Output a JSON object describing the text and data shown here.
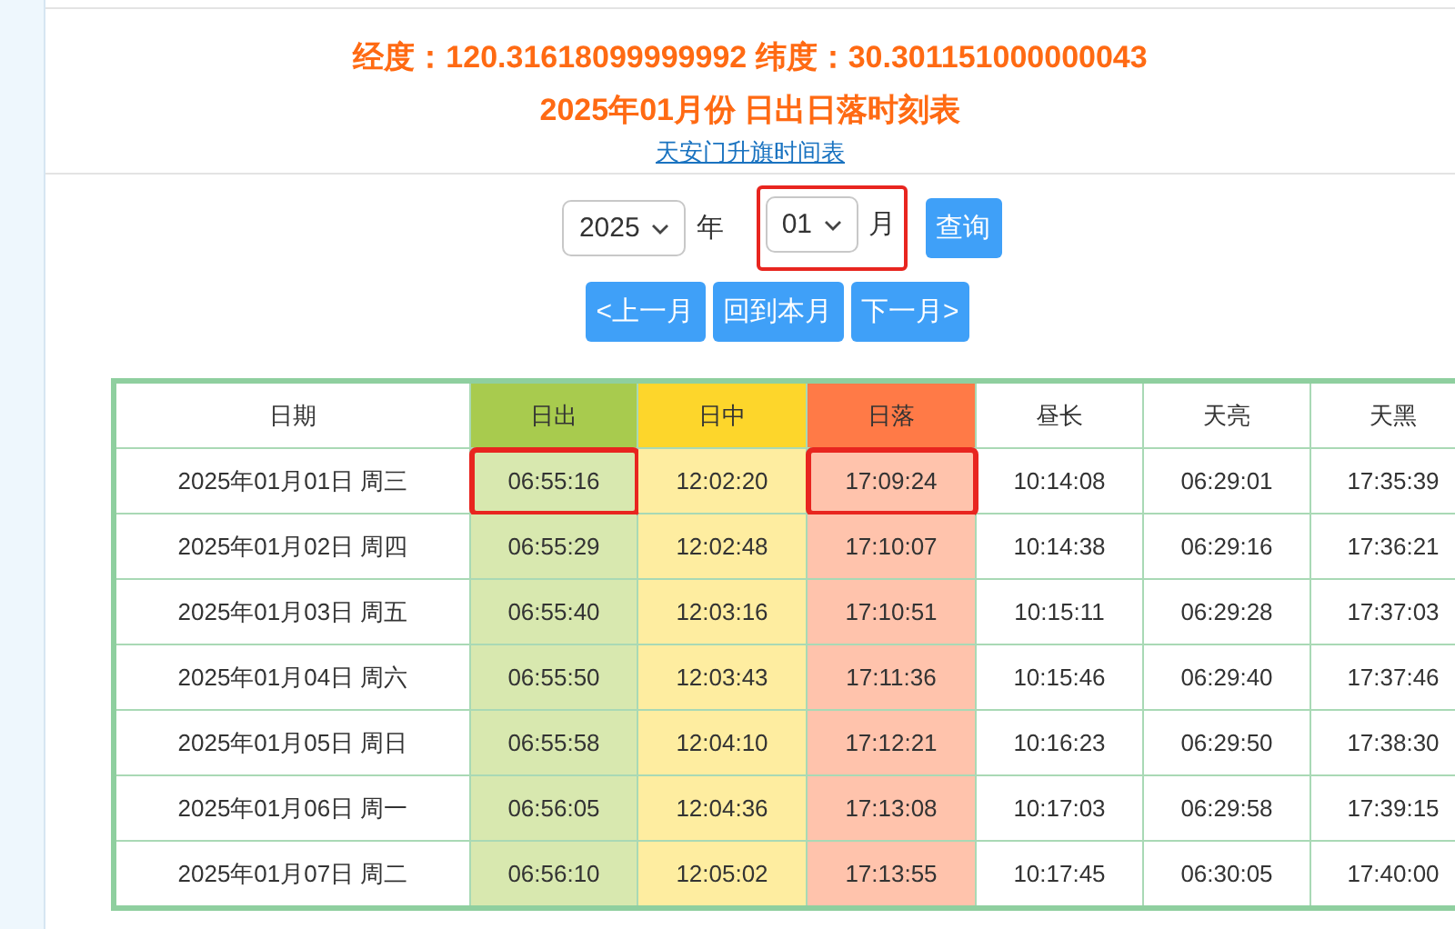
{
  "header": {
    "coordinates": "经度：120.31618099999992 纬度：30.301151000000043",
    "title": "2025年01月份 日出日落时刻表",
    "link": "天安门升旗时间表"
  },
  "query": {
    "year": {
      "value": "2025",
      "unit": "年",
      "highlighted": false
    },
    "month": {
      "value": "01",
      "unit": "月",
      "highlighted": true
    },
    "button": "查询"
  },
  "nav_buttons": [
    "<上一月",
    "回到本月",
    "下一月>"
  ],
  "table": {
    "columns": [
      {
        "label": "日期"
      },
      {
        "label": "日出",
        "color": "#a8cb4e"
      },
      {
        "label": "日中",
        "color": "#fdd62b"
      },
      {
        "label": "日落",
        "color": "#ff7a47"
      },
      {
        "label": "昼长"
      },
      {
        "label": "天亮"
      },
      {
        "label": "天黑"
      }
    ],
    "rows": [
      {
        "cells": [
          {
            "text": "2025年01月01日 周三",
            "highlighted": false
          },
          {
            "text": "06:55:16",
            "highlighted": true
          },
          {
            "text": "12:02:20",
            "highlighted": false
          },
          {
            "text": "17:09:24",
            "highlighted": true
          },
          {
            "text": "10:14:08",
            "highlighted": false
          },
          {
            "text": "06:29:01",
            "highlighted": false
          },
          {
            "text": "17:35:39",
            "highlighted": false
          }
        ]
      },
      {
        "cells": [
          {
            "text": "2025年01月02日 周四",
            "highlighted": false
          },
          {
            "text": "06:55:29",
            "highlighted": false
          },
          {
            "text": "12:02:48",
            "highlighted": false
          },
          {
            "text": "17:10:07",
            "highlighted": false
          },
          {
            "text": "10:14:38",
            "highlighted": false
          },
          {
            "text": "06:29:16",
            "highlighted": false
          },
          {
            "text": "17:36:21",
            "highlighted": false
          }
        ]
      },
      {
        "cells": [
          {
            "text": "2025年01月03日 周五",
            "highlighted": false
          },
          {
            "text": "06:55:40",
            "highlighted": false
          },
          {
            "text": "12:03:16",
            "highlighted": false
          },
          {
            "text": "17:10:51",
            "highlighted": false
          },
          {
            "text": "10:15:11",
            "highlighted": false
          },
          {
            "text": "06:29:28",
            "highlighted": false
          },
          {
            "text": "17:37:03",
            "highlighted": false
          }
        ]
      },
      {
        "cells": [
          {
            "text": "2025年01月04日 周六",
            "highlighted": false
          },
          {
            "text": "06:55:50",
            "highlighted": false
          },
          {
            "text": "12:03:43",
            "highlighted": false
          },
          {
            "text": "17:11:36",
            "highlighted": false
          },
          {
            "text": "10:15:46",
            "highlighted": false
          },
          {
            "text": "06:29:40",
            "highlighted": false
          },
          {
            "text": "17:37:46",
            "highlighted": false
          }
        ]
      },
      {
        "cells": [
          {
            "text": "2025年01月05日 周日",
            "highlighted": false
          },
          {
            "text": "06:55:58",
            "highlighted": false
          },
          {
            "text": "12:04:10",
            "highlighted": false
          },
          {
            "text": "17:12:21",
            "highlighted": false
          },
          {
            "text": "10:16:23",
            "highlighted": false
          },
          {
            "text": "06:29:50",
            "highlighted": false
          },
          {
            "text": "17:38:30",
            "highlighted": false
          }
        ]
      },
      {
        "cells": [
          {
            "text": "2025年01月06日 周一",
            "highlighted": false
          },
          {
            "text": "06:56:05",
            "highlighted": false
          },
          {
            "text": "12:04:36",
            "highlighted": false
          },
          {
            "text": "17:13:08",
            "highlighted": false
          },
          {
            "text": "10:17:03",
            "highlighted": false
          },
          {
            "text": "06:29:58",
            "highlighted": false
          },
          {
            "text": "17:39:15",
            "highlighted": false
          }
        ]
      },
      {
        "cells": [
          {
            "text": "2025年01月07日 周二",
            "highlighted": false
          },
          {
            "text": "06:56:10",
            "highlighted": false
          },
          {
            "text": "12:05:02",
            "highlighted": false
          },
          {
            "text": "17:13:55",
            "highlighted": false
          },
          {
            "text": "10:17:45",
            "highlighted": false
          },
          {
            "text": "06:30:05",
            "highlighted": false
          },
          {
            "text": "17:40:00",
            "highlighted": false
          }
        ]
      }
    ]
  }
}
